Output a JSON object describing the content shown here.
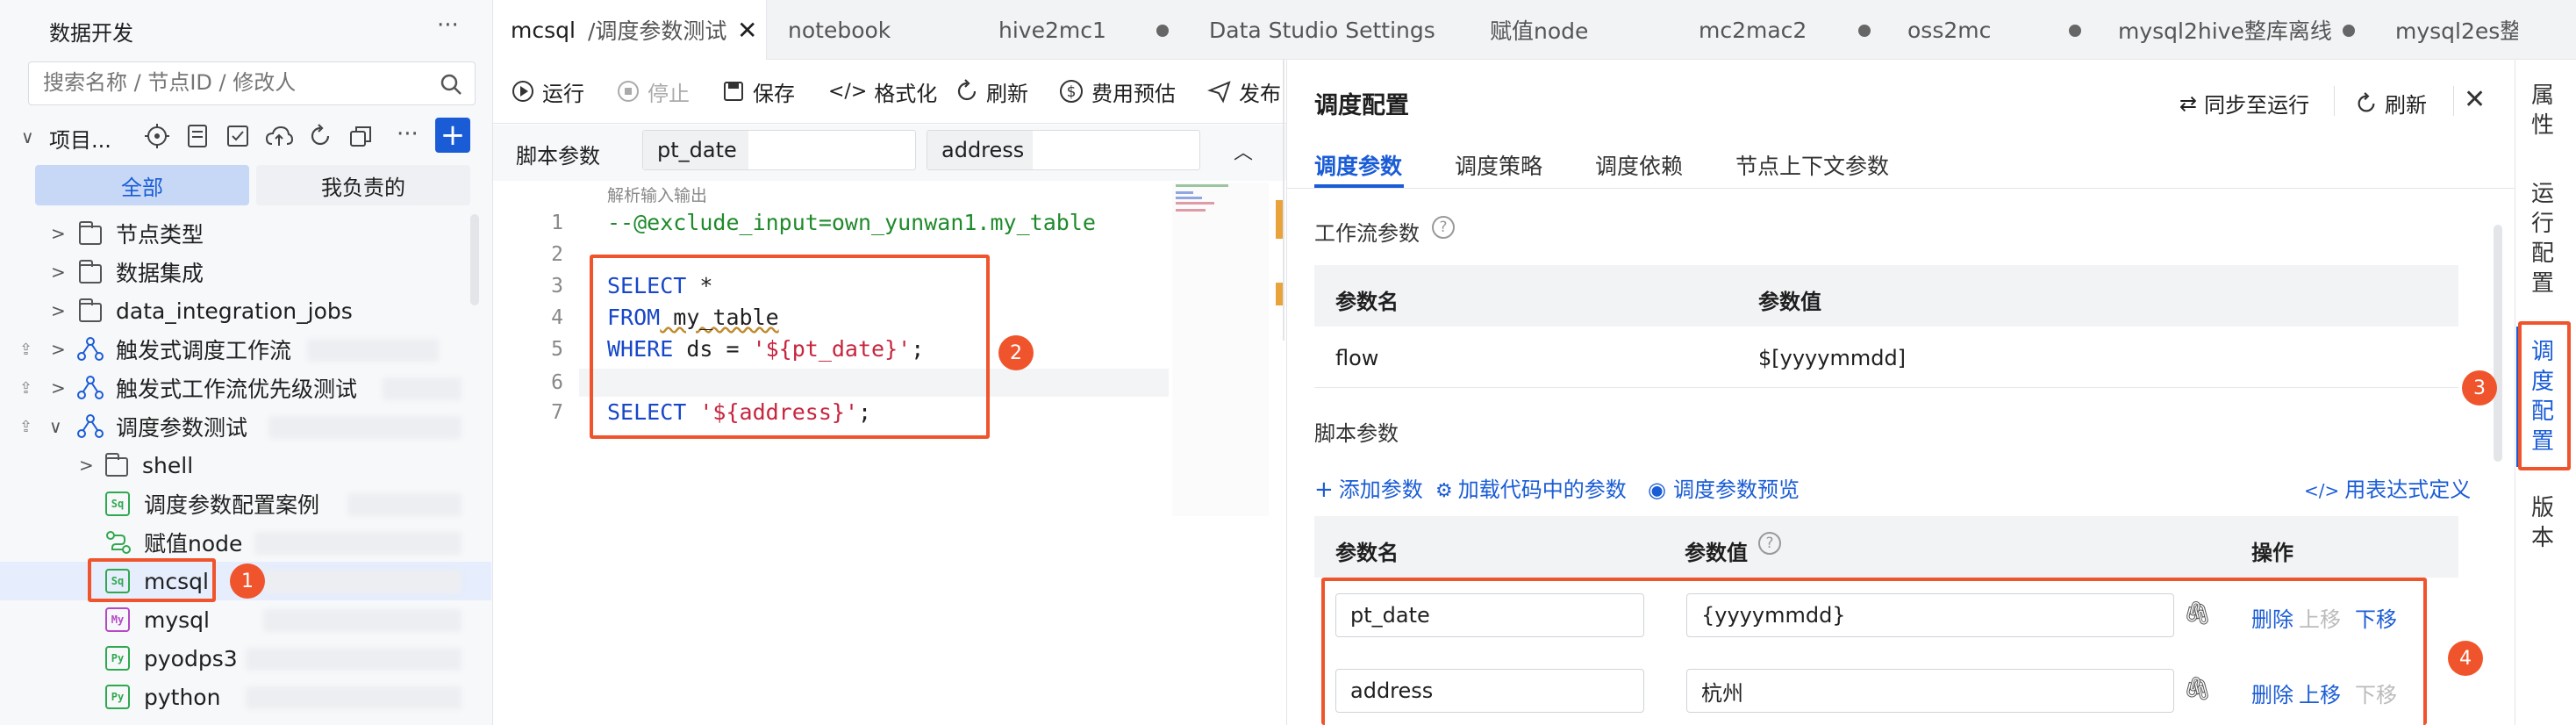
{
  "sidebar": {
    "title": "数据开发",
    "more": "···",
    "search_placeholder": "搜索名称 / 节点ID / 修改人",
    "project_label": "项目...",
    "filter_all": "全部",
    "filter_mine": "我负责的",
    "tree": [
      {
        "label": "节点类型"
      },
      {
        "label": "数据集成"
      },
      {
        "label": "data_integration_jobs"
      },
      {
        "label": "触发式调度工作流"
      },
      {
        "label": "触发式工作流优先级测试"
      },
      {
        "label": "调度参数测试"
      },
      {
        "label": "shell"
      },
      {
        "label": "调度参数配置案例"
      },
      {
        "label": "赋值node"
      },
      {
        "label": "mcsql"
      },
      {
        "label": "mysql"
      },
      {
        "label": "pyodps3"
      },
      {
        "label": "python"
      }
    ],
    "icon_text": {
      "sql": "Sq",
      "mysql": "My",
      "py3": "Py",
      "py": "Py"
    }
  },
  "tabs": [
    {
      "label": "mcsql"
    },
    {
      "label": "/调度参数测试"
    },
    {
      "label": "notebook"
    },
    {
      "label": "hive2mc1"
    },
    {
      "label": "Data Studio Settings"
    },
    {
      "label": "赋值node"
    },
    {
      "label": "mc2mac2"
    },
    {
      "label": "oss2mc"
    },
    {
      "label": "mysql2hive整库离线"
    },
    {
      "label": "mysql2es整"
    }
  ],
  "editor": {
    "toolbar": {
      "run": "运行",
      "stop": "停止",
      "save": "保存",
      "format": "格式化",
      "refresh": "刷新",
      "cost": "费用预估",
      "publish": "发布"
    },
    "script_params_label": "脚本参数",
    "param1_name": "pt_date",
    "param2_name": "address",
    "hint": "解析输入输出",
    "lines": [
      {
        "n": "1",
        "text": "--@exclude_input=own_yunwan1.my_table"
      },
      {
        "n": "2",
        "text": ""
      },
      {
        "n": "3",
        "text": "SELECT *"
      },
      {
        "n": "4",
        "text": "FROM my_table"
      },
      {
        "n": "5",
        "text": "WHERE ds = '${pt_date}';"
      },
      {
        "n": "6",
        "text": ""
      },
      {
        "n": "7",
        "text": "SELECT '${address}';"
      }
    ],
    "code_parts": {
      "l3_kw": "SELECT",
      "l3_rest": " *",
      "l4_kw": "FROM",
      "l4_rest": " my_table",
      "l5_kw": "WHERE",
      "l5_mid": " ds = ",
      "l5_str": "'${pt_date}'",
      "l5_end": ";",
      "l7_kw": "SELECT",
      "l7_sp": " ",
      "l7_str": "'${address}'",
      "l7_end": ";"
    }
  },
  "config": {
    "title": "调度配置",
    "sync_label": "同步至运行",
    "refresh_label": "刷新",
    "tabs": [
      "调度参数",
      "调度策略",
      "调度依赖",
      "节点上下文参数"
    ],
    "workflow_section": "工作流参数",
    "col_name": "参数名",
    "col_value": "参数值",
    "flow_row": {
      "name": "flow",
      "value": "$[yyyymmdd]"
    },
    "script_section": "脚本参数",
    "add_param": "添加参数",
    "load_params": "加载代码中的参数",
    "preview": "调度参数预览",
    "expr_define": "用表达式定义",
    "col_ops": "操作",
    "params": [
      {
        "name": "pt_date",
        "value": "{yyyymmdd}",
        "del": "删除",
        "up": "上移",
        "down": "下移"
      },
      {
        "name": "address",
        "value": "杭州",
        "del": "删除",
        "up": "上移",
        "down": "下移"
      }
    ]
  },
  "right_rail": [
    "属性",
    "运行配置",
    "调度配置",
    "版本"
  ],
  "badges": [
    "1",
    "2",
    "3",
    "4"
  ],
  "colors": {
    "accent": "#1a5cd6",
    "annotation": "#f0542c",
    "selected_bg": "#e6edfc"
  }
}
